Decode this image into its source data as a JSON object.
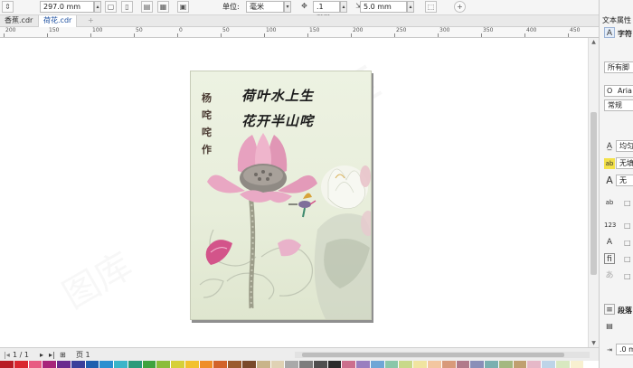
{
  "propbar": {
    "height_value": "297.0 mm",
    "units_label": "单位:",
    "units_value": "毫米",
    "nudge_value": ".1 mm",
    "duplicate_value": "5.0 mm"
  },
  "tabs": [
    {
      "label": "香蕉.cdr"
    },
    {
      "label": "荷花.cdr"
    },
    {
      "label": "+"
    }
  ],
  "ruler": {
    "ticks": [
      "200",
      "150",
      "100",
      "50",
      "0",
      "50",
      "100",
      "150",
      "200",
      "250",
      "300",
      "350",
      "400",
      "450"
    ]
  },
  "poster": {
    "author": "杨 咤 咤 作",
    "verse_line1": "荷叶水上生",
    "verse_line2": "花开半山咤"
  },
  "pagenav": {
    "page_count": "1 / 1",
    "page_tab": "页 1"
  },
  "docker": {
    "title": "文本属性",
    "char_header": "字符",
    "script_value": "所有脚",
    "font_value": "Aria",
    "style_value": "常规",
    "underline_value": "均匀",
    "fill_value": "无填",
    "outline_value": "无",
    "para_header": "段落",
    "indent_value": ".0 m"
  },
  "palette": [
    "#b81c24",
    "#d9262f",
    "#e85a82",
    "#a8247a",
    "#6a2a8e",
    "#3a3f9b",
    "#1f5fae",
    "#2a8fd0",
    "#3ab5c9",
    "#2a9b7a",
    "#3fa33f",
    "#8bbd3a",
    "#d6d03a",
    "#f2c12e",
    "#ef8e28",
    "#d2632a",
    "#9b5b2e",
    "#7a4a2a",
    "#c9b48a",
    "#e0d2b4",
    "#a9a9a9",
    "#7d7d7d",
    "#4f4f4f",
    "#2b2b2b",
    "#cc6f8d",
    "#9a7fbf",
    "#6fa6d6",
    "#8ac7a9",
    "#c8d98a",
    "#f0e4a0",
    "#f3c6a0",
    "#d89a7a",
    "#b07a8a",
    "#8a8fb8",
    "#7ab0b0",
    "#a4b880",
    "#c0a070",
    "#e6b8c8",
    "#bdd4e8",
    "#d8e8c0",
    "#f8f0d0",
    "#ffffff"
  ]
}
